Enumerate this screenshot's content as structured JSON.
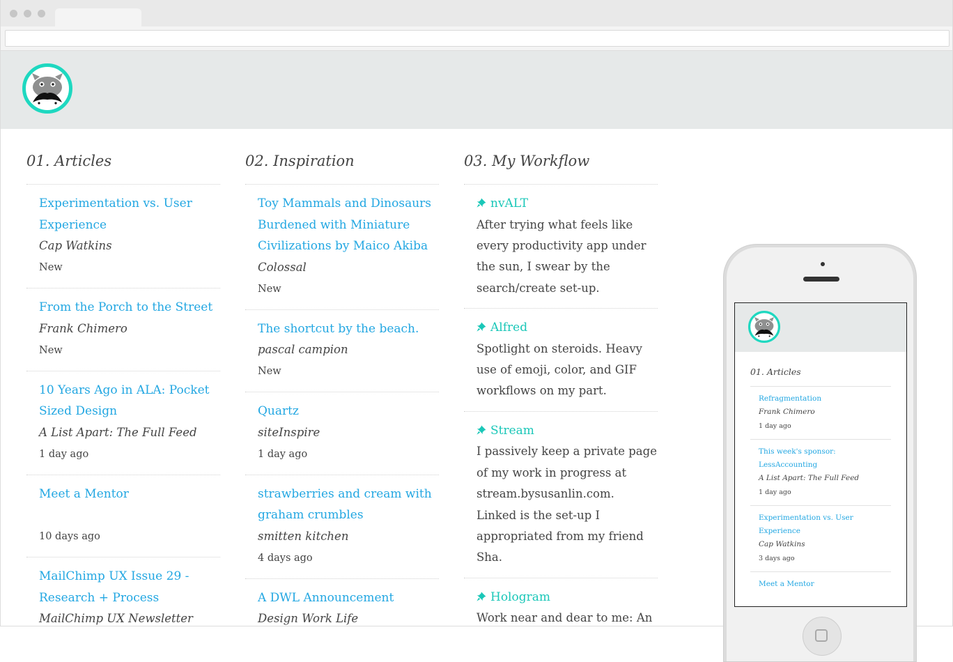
{
  "site": {
    "logo_icon": "hippo-mascot-logo-icon",
    "brand_color": "#1ed8c0"
  },
  "columns": [
    {
      "title": "01. Articles",
      "items": [
        {
          "title": "Experimentation vs. User Experience",
          "source": "Cap Watkins",
          "meta": "New"
        },
        {
          "title": "From the Porch to the Street",
          "source": "Frank Chimero",
          "meta": "New"
        },
        {
          "title": "10 Years Ago in ALA: Pocket Sized Design",
          "source": "A List Apart: The Full Feed",
          "meta": "1 day ago"
        },
        {
          "title": "Meet a Mentor",
          "source": "",
          "meta": "10 days ago"
        },
        {
          "title": "MailChimp UX Issue 29 - Research + Process",
          "source": "MailChimp UX Newsletter",
          "meta": ""
        }
      ]
    },
    {
      "title": "02. Inspiration",
      "items": [
        {
          "title": "Toy Mammals and Dinosaurs Burdened with Miniature Civilizations by Maico Akiba",
          "source": "Colossal",
          "meta": "New"
        },
        {
          "title": "The shortcut by the beach.",
          "source": "pascal campion",
          "meta": "New"
        },
        {
          "title": "Quartz",
          "source": "siteInspire",
          "meta": "1 day ago"
        },
        {
          "title": "strawberries and cream with graham crumbles",
          "source": "smitten kitchen",
          "meta": "4 days ago"
        },
        {
          "title": "A DWL Announcement",
          "source": "Design Work Life",
          "meta": ""
        }
      ]
    },
    {
      "title": "03. My Workflow",
      "pin_icon": "pushpin-icon",
      "items": [
        {
          "title": "nvALT",
          "description": "After trying what feels like every productivity app under the sun, I swear by the search/create set-up."
        },
        {
          "title": "Alfred",
          "description": "Spotlight on steroids. Heavy use of emoji, color, and GIF workflows on my part."
        },
        {
          "title": "Stream",
          "description": "I passively keep a private page of my work in progress at stream.bysusanlin.com. Linked is the set-up I appropriated from my friend Sha."
        },
        {
          "title": "Hologram",
          "description": "Work near and dear to me: An open source gem that builds"
        }
      ]
    }
  ],
  "mobile": {
    "column_title": "01. Articles",
    "items": [
      {
        "title": "Refragmentation",
        "source": "Frank Chimero",
        "meta": "1 day ago"
      },
      {
        "title": "This week's sponsor: LessAccounting",
        "source": "A List Apart: The Full Feed",
        "meta": "1 day ago"
      },
      {
        "title": "Experimentation vs. User Experience",
        "source": "Cap Watkins",
        "meta": "3 days ago"
      },
      {
        "title": "Meet a Mentor",
        "source": "",
        "meta": ""
      }
    ],
    "home_icon": "home-button-icon"
  }
}
